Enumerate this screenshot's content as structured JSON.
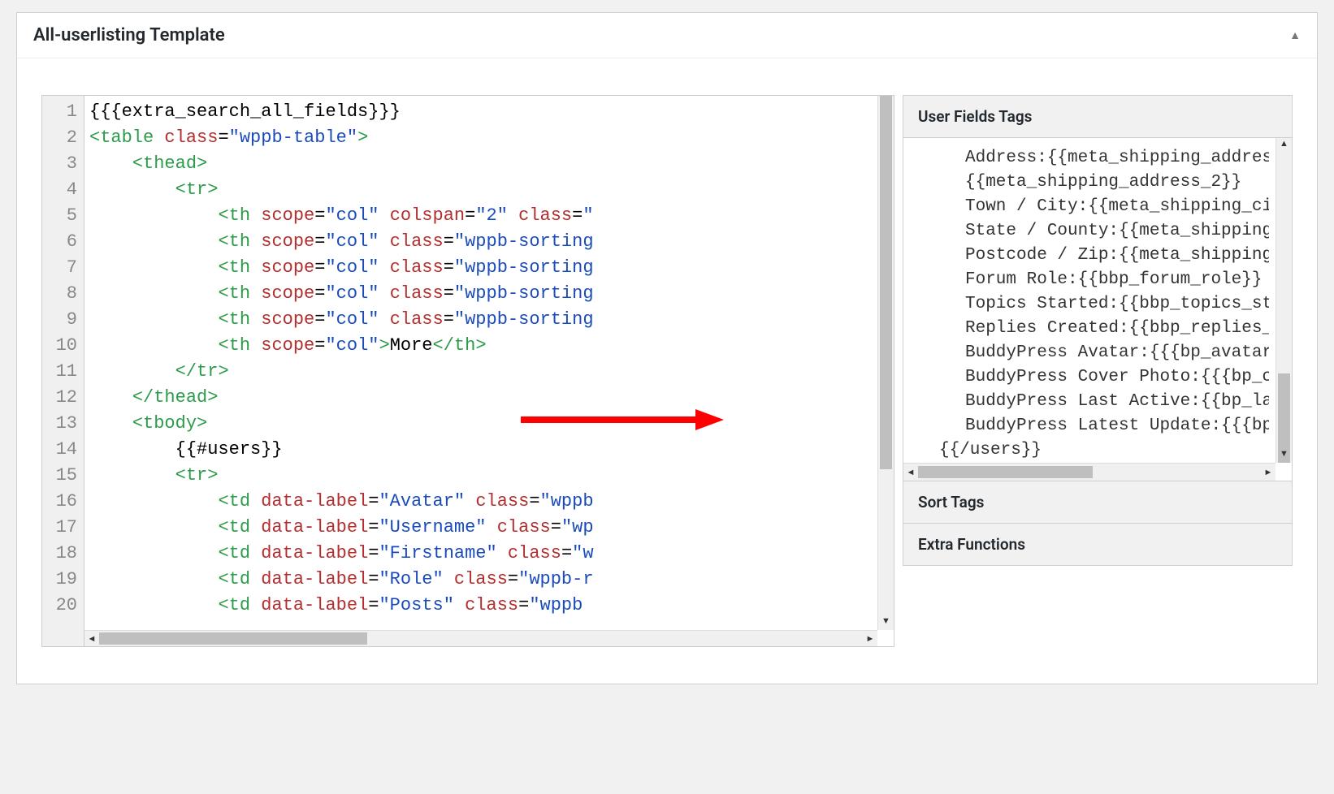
{
  "panel": {
    "title": "All-userlisting Template"
  },
  "code": {
    "lines": [
      [
        {
          "cls": "n",
          "txt": "{{{extra_search_all_fields}}}"
        }
      ],
      [
        {
          "cls": "br",
          "txt": "<"
        },
        {
          "cls": "t",
          "txt": "table"
        },
        {
          "cls": "n",
          "txt": " "
        },
        {
          "cls": "a",
          "txt": "class"
        },
        {
          "cls": "n",
          "txt": "="
        },
        {
          "cls": "v",
          "txt": "\"wppb-table\""
        },
        {
          "cls": "br",
          "txt": ">"
        }
      ],
      [
        {
          "cls": "n",
          "txt": "    "
        },
        {
          "cls": "br",
          "txt": "<"
        },
        {
          "cls": "t",
          "txt": "thead"
        },
        {
          "cls": "br",
          "txt": ">"
        }
      ],
      [
        {
          "cls": "n",
          "txt": "        "
        },
        {
          "cls": "br",
          "txt": "<"
        },
        {
          "cls": "t",
          "txt": "tr"
        },
        {
          "cls": "br",
          "txt": ">"
        }
      ],
      [
        {
          "cls": "n",
          "txt": "            "
        },
        {
          "cls": "br",
          "txt": "<"
        },
        {
          "cls": "t",
          "txt": "th"
        },
        {
          "cls": "n",
          "txt": " "
        },
        {
          "cls": "a",
          "txt": "scope"
        },
        {
          "cls": "n",
          "txt": "="
        },
        {
          "cls": "v",
          "txt": "\"col\""
        },
        {
          "cls": "n",
          "txt": " "
        },
        {
          "cls": "a",
          "txt": "colspan"
        },
        {
          "cls": "n",
          "txt": "="
        },
        {
          "cls": "v",
          "txt": "\"2\""
        },
        {
          "cls": "n",
          "txt": " "
        },
        {
          "cls": "a",
          "txt": "class"
        },
        {
          "cls": "n",
          "txt": "="
        },
        {
          "cls": "v",
          "txt": "\""
        }
      ],
      [
        {
          "cls": "n",
          "txt": "            "
        },
        {
          "cls": "br",
          "txt": "<"
        },
        {
          "cls": "t",
          "txt": "th"
        },
        {
          "cls": "n",
          "txt": " "
        },
        {
          "cls": "a",
          "txt": "scope"
        },
        {
          "cls": "n",
          "txt": "="
        },
        {
          "cls": "v",
          "txt": "\"col\""
        },
        {
          "cls": "n",
          "txt": " "
        },
        {
          "cls": "a",
          "txt": "class"
        },
        {
          "cls": "n",
          "txt": "="
        },
        {
          "cls": "v",
          "txt": "\"wppb-sorting"
        }
      ],
      [
        {
          "cls": "n",
          "txt": "            "
        },
        {
          "cls": "br",
          "txt": "<"
        },
        {
          "cls": "t",
          "txt": "th"
        },
        {
          "cls": "n",
          "txt": " "
        },
        {
          "cls": "a",
          "txt": "scope"
        },
        {
          "cls": "n",
          "txt": "="
        },
        {
          "cls": "v",
          "txt": "\"col\""
        },
        {
          "cls": "n",
          "txt": " "
        },
        {
          "cls": "a",
          "txt": "class"
        },
        {
          "cls": "n",
          "txt": "="
        },
        {
          "cls": "v",
          "txt": "\"wppb-sorting"
        }
      ],
      [
        {
          "cls": "n",
          "txt": "            "
        },
        {
          "cls": "br",
          "txt": "<"
        },
        {
          "cls": "t",
          "txt": "th"
        },
        {
          "cls": "n",
          "txt": " "
        },
        {
          "cls": "a",
          "txt": "scope"
        },
        {
          "cls": "n",
          "txt": "="
        },
        {
          "cls": "v",
          "txt": "\"col\""
        },
        {
          "cls": "n",
          "txt": " "
        },
        {
          "cls": "a",
          "txt": "class"
        },
        {
          "cls": "n",
          "txt": "="
        },
        {
          "cls": "v",
          "txt": "\"wppb-sorting"
        }
      ],
      [
        {
          "cls": "n",
          "txt": "            "
        },
        {
          "cls": "br",
          "txt": "<"
        },
        {
          "cls": "t",
          "txt": "th"
        },
        {
          "cls": "n",
          "txt": " "
        },
        {
          "cls": "a",
          "txt": "scope"
        },
        {
          "cls": "n",
          "txt": "="
        },
        {
          "cls": "v",
          "txt": "\"col\""
        },
        {
          "cls": "n",
          "txt": " "
        },
        {
          "cls": "a",
          "txt": "class"
        },
        {
          "cls": "n",
          "txt": "="
        },
        {
          "cls": "v",
          "txt": "\"wppb-sorting"
        }
      ],
      [
        {
          "cls": "n",
          "txt": "            "
        },
        {
          "cls": "br",
          "txt": "<"
        },
        {
          "cls": "t",
          "txt": "th"
        },
        {
          "cls": "n",
          "txt": " "
        },
        {
          "cls": "a",
          "txt": "scope"
        },
        {
          "cls": "n",
          "txt": "="
        },
        {
          "cls": "v",
          "txt": "\"col\""
        },
        {
          "cls": "br",
          "txt": ">"
        },
        {
          "cls": "n",
          "txt": "More"
        },
        {
          "cls": "br",
          "txt": "</"
        },
        {
          "cls": "t",
          "txt": "th"
        },
        {
          "cls": "br",
          "txt": ">"
        }
      ],
      [
        {
          "cls": "n",
          "txt": "        "
        },
        {
          "cls": "br",
          "txt": "</"
        },
        {
          "cls": "t",
          "txt": "tr"
        },
        {
          "cls": "br",
          "txt": ">"
        }
      ],
      [
        {
          "cls": "n",
          "txt": "    "
        },
        {
          "cls": "br",
          "txt": "</"
        },
        {
          "cls": "t",
          "txt": "thead"
        },
        {
          "cls": "br",
          "txt": ">"
        }
      ],
      [
        {
          "cls": "n",
          "txt": "    "
        },
        {
          "cls": "br",
          "txt": "<"
        },
        {
          "cls": "t",
          "txt": "tbody"
        },
        {
          "cls": "br",
          "txt": ">"
        }
      ],
      [
        {
          "cls": "n",
          "txt": "        {{#users}}"
        }
      ],
      [
        {
          "cls": "n",
          "txt": "        "
        },
        {
          "cls": "br",
          "txt": "<"
        },
        {
          "cls": "t",
          "txt": "tr"
        },
        {
          "cls": "br",
          "txt": ">"
        }
      ],
      [
        {
          "cls": "n",
          "txt": "            "
        },
        {
          "cls": "br",
          "txt": "<"
        },
        {
          "cls": "t",
          "txt": "td"
        },
        {
          "cls": "n",
          "txt": " "
        },
        {
          "cls": "a",
          "txt": "data-label"
        },
        {
          "cls": "n",
          "txt": "="
        },
        {
          "cls": "v",
          "txt": "\"Avatar\""
        },
        {
          "cls": "n",
          "txt": " "
        },
        {
          "cls": "a",
          "txt": "class"
        },
        {
          "cls": "n",
          "txt": "="
        },
        {
          "cls": "v",
          "txt": "\"wppb"
        }
      ],
      [
        {
          "cls": "n",
          "txt": "            "
        },
        {
          "cls": "br",
          "txt": "<"
        },
        {
          "cls": "t",
          "txt": "td"
        },
        {
          "cls": "n",
          "txt": " "
        },
        {
          "cls": "a",
          "txt": "data-label"
        },
        {
          "cls": "n",
          "txt": "="
        },
        {
          "cls": "v",
          "txt": "\"Username\""
        },
        {
          "cls": "n",
          "txt": " "
        },
        {
          "cls": "a",
          "txt": "class"
        },
        {
          "cls": "n",
          "txt": "="
        },
        {
          "cls": "v",
          "txt": "\"wp"
        }
      ],
      [
        {
          "cls": "n",
          "txt": "            "
        },
        {
          "cls": "br",
          "txt": "<"
        },
        {
          "cls": "t",
          "txt": "td"
        },
        {
          "cls": "n",
          "txt": " "
        },
        {
          "cls": "a",
          "txt": "data-label"
        },
        {
          "cls": "n",
          "txt": "="
        },
        {
          "cls": "v",
          "txt": "\"Firstname\""
        },
        {
          "cls": "n",
          "txt": " "
        },
        {
          "cls": "a",
          "txt": "class"
        },
        {
          "cls": "n",
          "txt": "="
        },
        {
          "cls": "v",
          "txt": "\"w"
        }
      ],
      [
        {
          "cls": "n",
          "txt": "            "
        },
        {
          "cls": "br",
          "txt": "<"
        },
        {
          "cls": "t",
          "txt": "td"
        },
        {
          "cls": "n",
          "txt": " "
        },
        {
          "cls": "a",
          "txt": "data-label"
        },
        {
          "cls": "n",
          "txt": "="
        },
        {
          "cls": "v",
          "txt": "\"Role\""
        },
        {
          "cls": "n",
          "txt": " "
        },
        {
          "cls": "a",
          "txt": "class"
        },
        {
          "cls": "n",
          "txt": "="
        },
        {
          "cls": "v",
          "txt": "\"wppb-r"
        }
      ],
      [
        {
          "cls": "n",
          "txt": "            "
        },
        {
          "cls": "br",
          "txt": "<"
        },
        {
          "cls": "t",
          "txt": "td"
        },
        {
          "cls": "n",
          "txt": " "
        },
        {
          "cls": "a",
          "txt": "data-label"
        },
        {
          "cls": "n",
          "txt": "="
        },
        {
          "cls": "v",
          "txt": "\"Posts\""
        },
        {
          "cls": "n",
          "txt": " "
        },
        {
          "cls": "a",
          "txt": "class"
        },
        {
          "cls": "n",
          "txt": "="
        },
        {
          "cls": "v",
          "txt": "\"wppb"
        }
      ]
    ],
    "line_count": 20
  },
  "sidebar": {
    "sections": {
      "fields": {
        "title": "User Fields Tags"
      },
      "sort": {
        "title": "Sort Tags"
      },
      "extras": {
        "title": "Extra Functions"
      }
    },
    "tags": [
      {
        "indent": 1,
        "text": "Address:{{meta_shipping_addres"
      },
      {
        "indent": 1,
        "text": "{{meta_shipping_address_2}}"
      },
      {
        "indent": 1,
        "text": "Town / City:{{meta_shipping_ci"
      },
      {
        "indent": 1,
        "text": "State / County:{{meta_shipping"
      },
      {
        "indent": 1,
        "text": "Postcode / Zip:{{meta_shipping"
      },
      {
        "indent": 1,
        "text": "Forum Role:{{bbp_forum_role}}"
      },
      {
        "indent": 1,
        "text": "Topics Started:{{bbp_topics_st"
      },
      {
        "indent": 1,
        "text": "Replies Created:{{bbp_replies_"
      },
      {
        "indent": 1,
        "text": "BuddyPress Avatar:{{{bp_avatar"
      },
      {
        "indent": 1,
        "text": "BuddyPress Cover Photo:{{{bp_c"
      },
      {
        "indent": 1,
        "text": "BuddyPress Last Active:{{bp_la"
      },
      {
        "indent": 1,
        "text": "BuddyPress Latest Update:{{{bp"
      },
      {
        "indent": 0,
        "text": "{{/users}}"
      }
    ]
  }
}
